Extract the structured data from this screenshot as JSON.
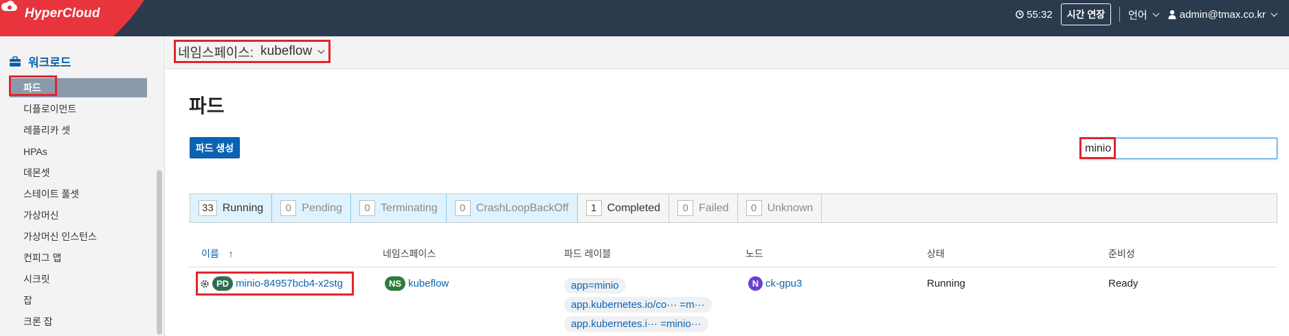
{
  "app": {
    "logo_text": "HyperCloud"
  },
  "header": {
    "session_timer": "55:32",
    "extend_button": "시간 연장",
    "language_label": "언어",
    "user_label": "admin@tmax.co.kr"
  },
  "sidebar": {
    "section_label": "워크로드",
    "items": [
      {
        "label": "파드",
        "active": true
      },
      {
        "label": "디플로이먼트"
      },
      {
        "label": "레플리카 셋"
      },
      {
        "label": "HPAs"
      },
      {
        "label": "데몬셋"
      },
      {
        "label": "스테이트 풀셋"
      },
      {
        "label": "가상머신"
      },
      {
        "label": "가상머신 인스턴스"
      },
      {
        "label": "컨피그 맵"
      },
      {
        "label": "시크릿"
      },
      {
        "label": "잡"
      },
      {
        "label": "크론 잡"
      }
    ]
  },
  "namespace_bar": {
    "label": "네임스페이스:",
    "value": "kubeflow"
  },
  "main": {
    "title": "파드",
    "create_button": "파드 생성",
    "search_value": "minio"
  },
  "status_filters": [
    {
      "count": "33",
      "label": "Running"
    },
    {
      "count": "0",
      "label": "Pending"
    },
    {
      "count": "0",
      "label": "Terminating"
    },
    {
      "count": "0",
      "label": "CrashLoopBackOff"
    },
    {
      "count": "1",
      "label": "Completed"
    },
    {
      "count": "0",
      "label": "Failed"
    },
    {
      "count": "0",
      "label": "Unknown"
    }
  ],
  "table": {
    "columns": [
      "이름",
      "네임스페이스",
      "파드 레이블",
      "노드",
      "상태",
      "준비성"
    ],
    "sort_indicator": "↑",
    "rows": [
      {
        "name_badge": "PD",
        "name": "minio-84957bcb4-x2stg",
        "ns_badge": "NS",
        "namespace": "kubeflow",
        "labels": [
          "app=minio",
          "app.kubernetes.io/co··· =m···",
          "app.kubernetes.i··· =minio···"
        ],
        "node_badge": "N",
        "node": "ck-gpu3",
        "status": "Running",
        "readiness": "Ready"
      }
    ]
  },
  "colors": {
    "topbar": "#2b3a4d",
    "logo_red": "#e8343c",
    "accent": "#0b64b3",
    "highlight": "#e3232c"
  }
}
